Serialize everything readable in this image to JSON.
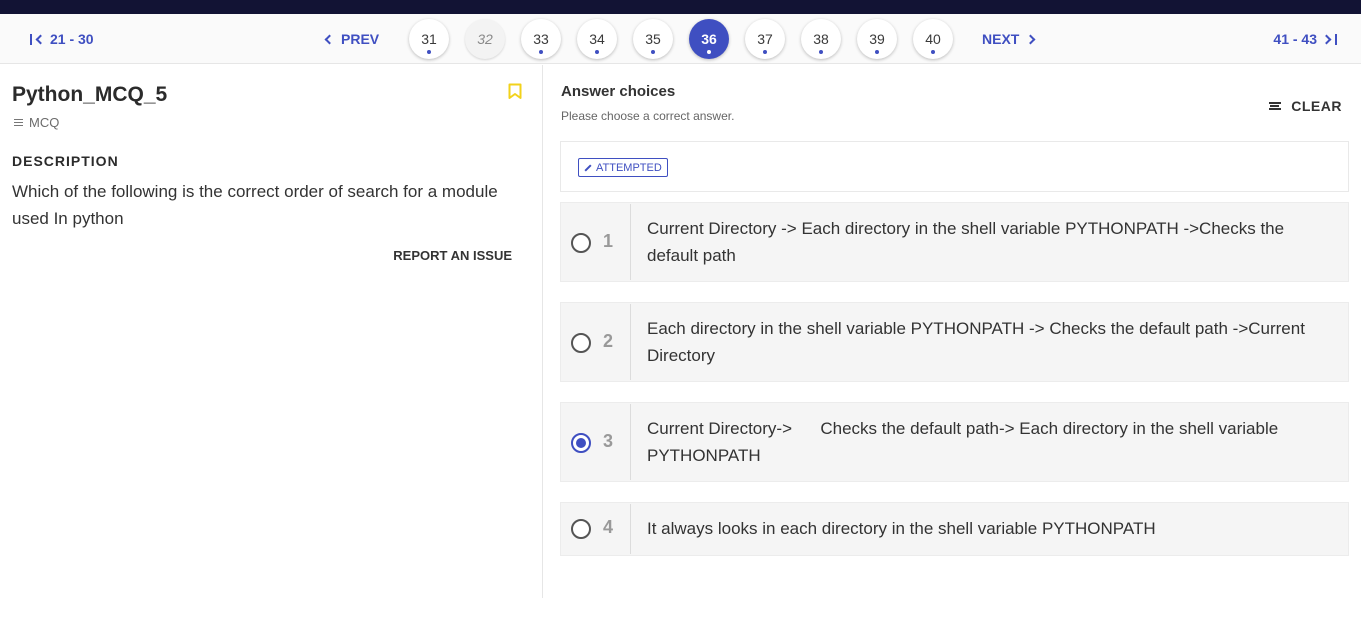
{
  "nav": {
    "range_prev": "21 - 30",
    "prev_label": "PREV",
    "next_label": "NEXT",
    "range_next": "41 - 43",
    "pages": [
      "31",
      "32",
      "33",
      "34",
      "35",
      "36",
      "37",
      "38",
      "39",
      "40"
    ],
    "active_page": "36"
  },
  "question": {
    "title": "Python_MCQ_5",
    "type": "MCQ",
    "description_heading": "DESCRIPTION",
    "description": "Which of the following is the correct order of search for a module used In python",
    "report_label": "REPORT AN ISSUE"
  },
  "answers": {
    "heading": "Answer choices",
    "subheading": "Please choose a correct answer.",
    "clear_label": "CLEAR",
    "status": "ATTEMPTED",
    "choices": [
      {
        "number": "1",
        "text": "Current Directory -> Each directory in the shell variable PYTHONPATH ->Checks the default path",
        "selected": false
      },
      {
        "number": "2",
        "text": "Each directory in the shell variable PYTHONPATH -> Checks the default path ->Current Directory",
        "selected": false
      },
      {
        "number": "3",
        "text": "Current Directory->      Checks the default path-> Each directory in the shell variable PYTHONPATH",
        "selected": true
      },
      {
        "number": "4",
        "text": "It always looks in each directory in the shell variable PYTHONPATH",
        "selected": false
      }
    ]
  },
  "colors": {
    "accent": "#3f4fc1",
    "topbar": "#121334",
    "bookmark": "#f2d21b"
  }
}
